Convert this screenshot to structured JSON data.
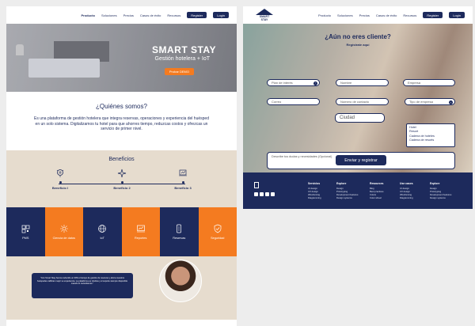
{
  "nav": {
    "items": [
      "Producto",
      "Soluciones",
      "Precios",
      "Casos de éxito",
      "Recursos"
    ],
    "register": "Register",
    "login": "Login"
  },
  "logo": {
    "line1": "SMART",
    "line2": "STAY"
  },
  "hero": {
    "title": "SMART STAY",
    "subtitle": "Gestión hotelera + IoT",
    "cta": "Probar DEMO"
  },
  "about": {
    "title": "¿Quiénes somos?",
    "text": "Es una plataforma de gestión hotelera que integra reservas, operaciones y experiencia del huésped en un solo sistema. Digitalizamos tu hotel para que ahorres tiempo, reduzcas costos y ofrezcas un servicio de primer nivel."
  },
  "benefits": {
    "title": "Beneficios",
    "items": [
      "Beneficio I",
      "Beneficio 2",
      "Beneficio 3"
    ]
  },
  "features": [
    {
      "label": "PMS",
      "icon": "qr-icon"
    },
    {
      "label": "Ciencia de datos",
      "icon": "data-science-icon"
    },
    {
      "label": "IoT",
      "icon": "globe-icon"
    },
    {
      "label": "Reportes",
      "icon": "report-icon"
    },
    {
      "label": "Reservas",
      "icon": "mobile-booking-icon"
    },
    {
      "label": "Seguridad",
      "icon": "shield-check-icon"
    }
  ],
  "testimonial": {
    "quote": "\"Con Smart Stay hemos reducido un 30% el tiempo de gestión de reservas y ahora nuestros huéspedes califican mejor su experiencia. La plataforma es intuitiva y el soporte siempre disponible cuando lo necesitamos.\""
  },
  "contact": {
    "title": "¿Aún no eres cliente?",
    "subtitle": "Regístrate aquí",
    "plan_placeholder": "Plan de interés",
    "name_placeholder": "Nombre",
    "company_placeholder": "Empresa",
    "email_placeholder": "Correo",
    "phone_placeholder": "Número de contacto",
    "type_placeholder": "Tipo de empresa",
    "city_placeholder": "Ciudad",
    "type_options": [
      "Hotel",
      "Resort",
      "Cadena de hoteles",
      "Cadena de resorts"
    ],
    "message_placeholder": "Describe tus dudas y necesidades (Opcional)",
    "submit": "Enviar y registrar"
  },
  "footer": {
    "columns": [
      {
        "title": "Servicios",
        "links": [
          "UI design",
          "UX design",
          "Wireframing",
          "Diagramming"
        ]
      },
      {
        "title": "Explore",
        "links": [
          "Design",
          "Prototyping",
          "Development features",
          "Design systems"
        ]
      },
      {
        "title": "Resources",
        "links": [
          "Blog",
          "Best practices",
          "Colors",
          "Color wheel"
        ]
      },
      {
        "title": "Use cases",
        "links": [
          "UI design",
          "UX design",
          "Wireframing",
          "Diagramming"
        ]
      },
      {
        "title": "Explore",
        "links": [
          "Design",
          "Prototyping",
          "Development features",
          "Design systems"
        ]
      }
    ]
  },
  "colors": {
    "navy": "#1d2a5c",
    "orange": "#f47b20",
    "beige": "#e6dcce"
  }
}
